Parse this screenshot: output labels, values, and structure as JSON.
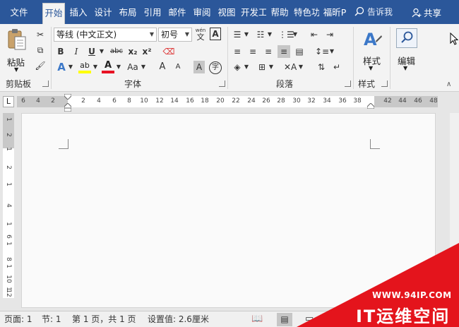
{
  "tabs": [
    "文件",
    "开始",
    "插入",
    "设计",
    "布局",
    "引用",
    "邮件",
    "审阅",
    "视图",
    "开发工",
    "帮助",
    "特色功",
    "福昕P"
  ],
  "active_tab": "开始",
  "tell_me": "告诉我",
  "share": "共享",
  "clipboard": {
    "paste": "粘贴",
    "label": "剪贴板"
  },
  "font": {
    "family": "等线 (中文正文)",
    "size": "初号",
    "label": "字体",
    "wen": "wén",
    "wen_char": "文",
    "a_box": "A",
    "bold": "B",
    "italic": "I",
    "underline": "U",
    "strike": "abc",
    "subscript": "x₂",
    "superscript": "x²",
    "text_effects": "A",
    "highlight": "ab",
    "font_color": "A",
    "change_case": "Aa",
    "grow": "A",
    "shrink": "A",
    "char_shade": "A",
    "enclose": "字"
  },
  "paragraph": {
    "label": "段落"
  },
  "styles": {
    "label": "样式",
    "button": "样式"
  },
  "editing": {
    "button": "编辑"
  },
  "ruler": {
    "tab_marker": "L",
    "ticks": [
      "6",
      "4",
      "2",
      "2",
      "4",
      "6",
      "8",
      "10",
      "12",
      "14",
      "16",
      "18",
      "20",
      "22",
      "24",
      "26",
      "28",
      "30",
      "32",
      "34",
      "36",
      "38",
      "42",
      "44",
      "46",
      "48"
    ],
    "vticks": [
      "1",
      "2",
      "1",
      "2",
      "1",
      "4",
      "1",
      "6",
      "1",
      "8",
      "1",
      "10",
      "1",
      "12"
    ]
  },
  "statusbar": {
    "page": "页面: 1",
    "section": "节: 1",
    "pages": "第 1 页，共 1 页",
    "setting": "设置值: 2.6厘米"
  },
  "watermark": {
    "url": "WWW.94IP.COM",
    "brand": "IT运维空间"
  },
  "colors": {
    "accent": "#2b579a",
    "highlight": "#ffff00",
    "font_red": "#e81123",
    "watermark": "#e4141c"
  }
}
